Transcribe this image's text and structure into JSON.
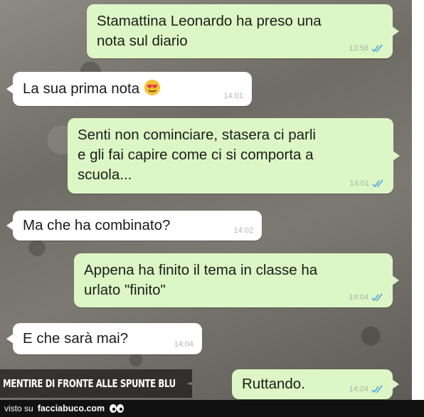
{
  "messages": [
    {
      "direction": "out",
      "text": "Stamattina Leonardo ha preso una\nnota sul diario",
      "time": "13:58",
      "read": true
    },
    {
      "direction": "in",
      "text": "La sua prima nota",
      "emoji": "heart-eyes-emoji",
      "time": "14:01"
    },
    {
      "direction": "out",
      "text": "Senti non cominciare, stasera ci parli\ne gli fai capire come ci si comporta a\nscuola...",
      "time": "14:01",
      "read": true
    },
    {
      "direction": "in",
      "text": "Ma che ha combinato?",
      "time": "14:02"
    },
    {
      "direction": "out",
      "text": "Appena ha finito il tema in classe ha\nurlato \"finito\"",
      "time": "14:04",
      "read": true
    },
    {
      "direction": "in",
      "text": "E che sarà mai?",
      "time": "14:04"
    },
    {
      "direction": "out",
      "text": "Ruttando.",
      "time": "14:04",
      "read": true
    }
  ],
  "watermark": {
    "text": "MENTIRE DI FRONTE ALLE SPUNTE BLU"
  },
  "footer": {
    "prefix": "visto su",
    "site": "facciabuco.com"
  },
  "colors": {
    "outgoing_bubble": "#dcf7c5",
    "incoming_bubble": "#ffffff",
    "read_ticks": "#4fa3e0"
  }
}
